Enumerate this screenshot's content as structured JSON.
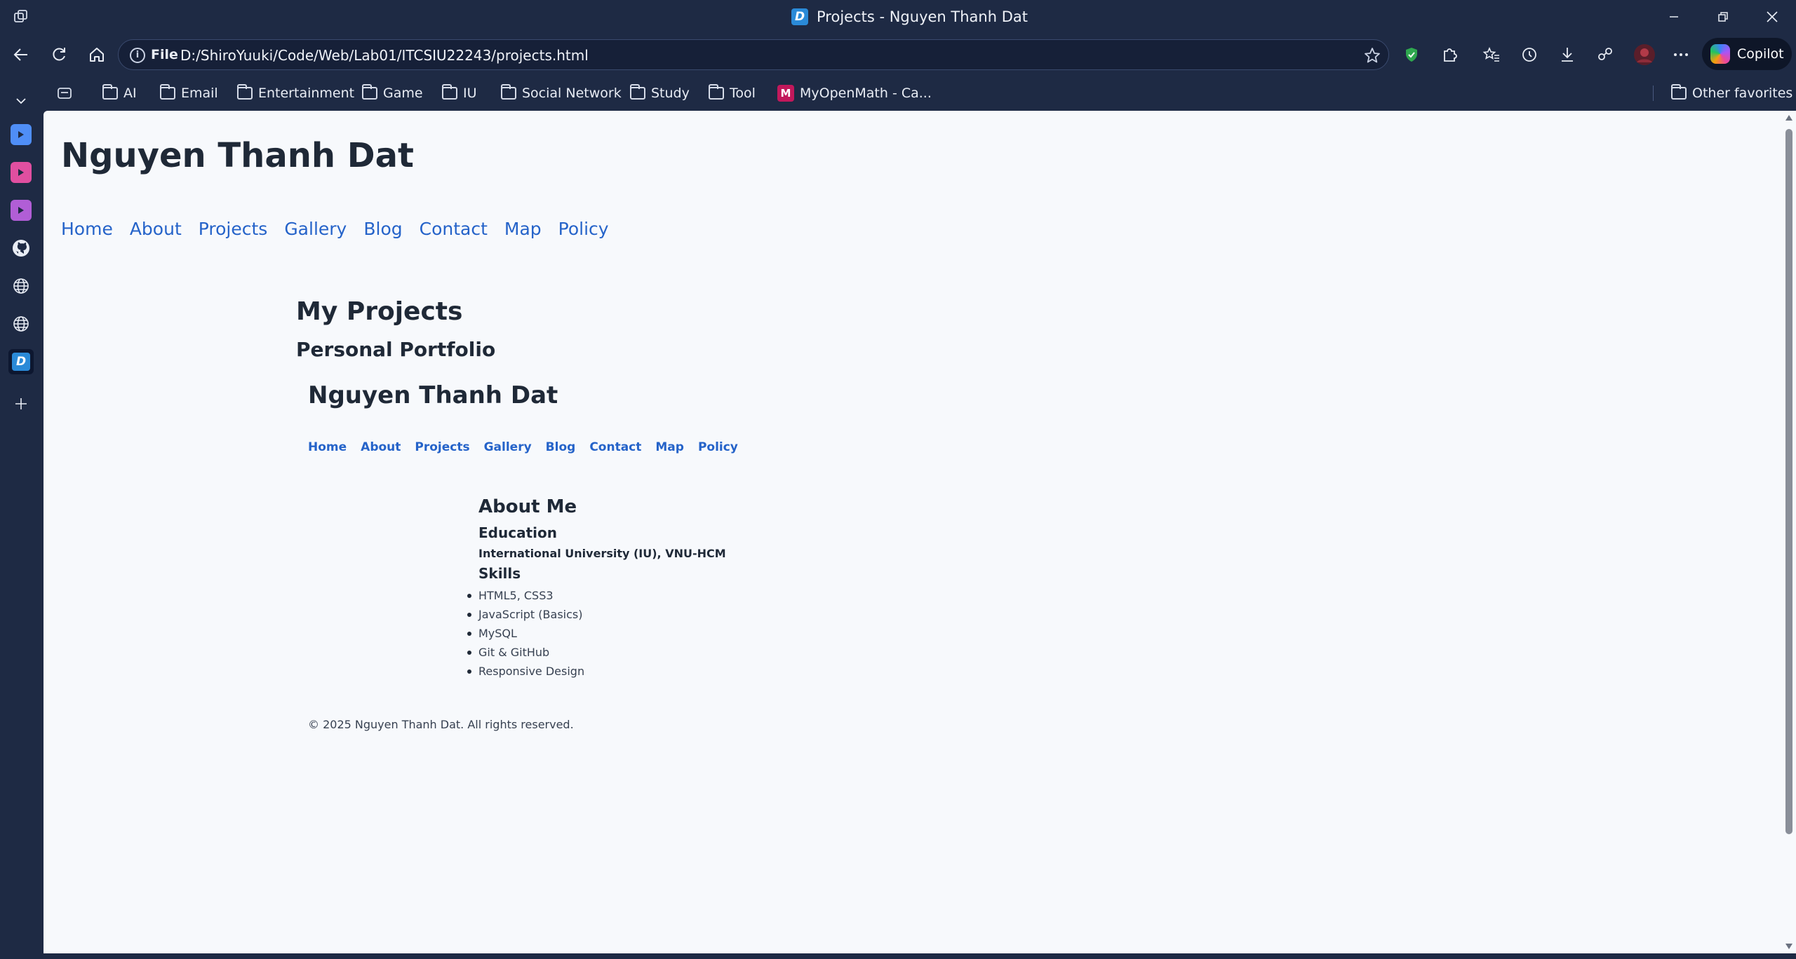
{
  "browser": {
    "window_title": "Projects - Nguyen Thanh Dat",
    "favicon_letter": "D",
    "address": {
      "scheme_label": "File",
      "url": "D:/ShiroYuuki/Code/Web/Lab01/ITCSIU22243/projects.html"
    },
    "copilot_label": "Copilot",
    "bookmarks": [
      {
        "label": "AI",
        "type": "folder"
      },
      {
        "label": "Email",
        "type": "folder"
      },
      {
        "label": "Entertainment",
        "type": "folder"
      },
      {
        "label": "Game",
        "type": "folder"
      },
      {
        "label": "IU",
        "type": "folder"
      },
      {
        "label": "Social Network",
        "type": "folder"
      },
      {
        "label": "Study",
        "type": "folder"
      },
      {
        "label": "Tool",
        "type": "folder"
      },
      {
        "label": "MyOpenMath - Ca...",
        "type": "link",
        "icon_letter": "M"
      }
    ],
    "other_favorites": "Other favorites",
    "sidebar_tabs": [
      {
        "icon": "video-tab-icon",
        "color": "#4f8ef7"
      },
      {
        "icon": "video-tab-icon",
        "color": "#e04fa0"
      },
      {
        "icon": "video-tab-icon",
        "color": "#b15ed6"
      },
      {
        "icon": "github-icon",
        "color": "#e8ecf4"
      },
      {
        "icon": "globe-icon",
        "color": "#e8ecf4"
      },
      {
        "icon": "globe-icon",
        "color": "#e8ecf4"
      },
      {
        "icon": "d-favicon-icon",
        "color": "#2a8ad8",
        "letter": "D"
      }
    ]
  },
  "page": {
    "site_title": "Nguyen Thanh Dat",
    "nav": [
      "Home",
      "About",
      "Projects",
      "Gallery",
      "Blog",
      "Contact",
      "Map",
      "Policy"
    ],
    "heading": "My Projects",
    "subheading": "Personal Portfolio",
    "embedded": {
      "site_title": "Nguyen Thanh Dat",
      "nav": [
        "Home",
        "About",
        "Projects",
        "Gallery",
        "Blog",
        "Contact",
        "Map",
        "Policy"
      ],
      "about_title": "About Me",
      "education_title": "Education",
      "education_text": "International University (IU), VNU-HCM",
      "skills_title": "Skills",
      "skills": [
        "HTML5, CSS3",
        "JavaScript (Basics)",
        "MySQL",
        "Git & GitHub",
        "Responsive Design"
      ],
      "footer": "© 2025 Nguyen Thanh Dat. All rights reserved."
    }
  },
  "colors": {
    "chrome_bg": "#1e2a44",
    "page_bg": "#f7f9fc",
    "link": "#2563c9",
    "text": "#1f2937"
  }
}
